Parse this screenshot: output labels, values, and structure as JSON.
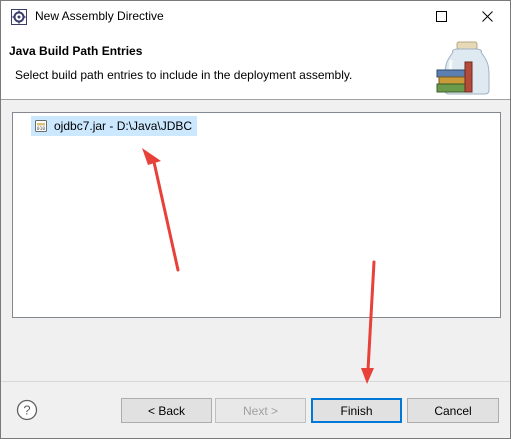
{
  "window": {
    "title": "New Assembly Directive",
    "icon": "eclipse-gear-icon",
    "controls": [
      "maximize-icon",
      "close-icon"
    ]
  },
  "banner": {
    "heading": "Java Build Path Entries",
    "description": "Select build path entries to include in the deployment assembly.",
    "icon": "library-jar-icon"
  },
  "entries": [
    {
      "label": "ojdbc7.jar - D:\\Java\\JDBC",
      "icon": "jar-file-icon",
      "selected": true
    }
  ],
  "footer": {
    "help_icon": "help-icon",
    "back_label": "< Back",
    "next_label": "Next >",
    "finish_label": "Finish",
    "cancel_label": "Cancel"
  },
  "colors": {
    "selection": "#cce8ff",
    "arrow": "#e8413a",
    "default_button_border": "#0078d7"
  }
}
